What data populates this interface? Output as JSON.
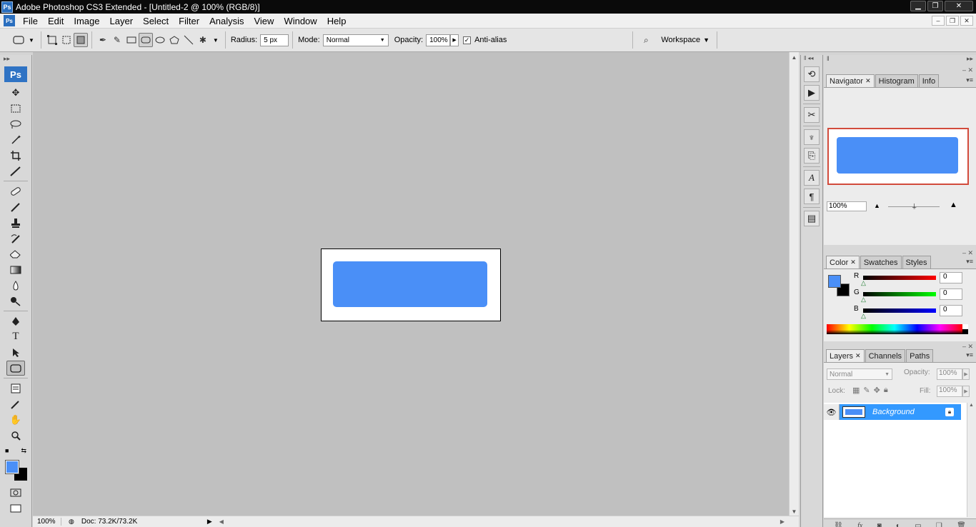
{
  "window": {
    "title": "Adobe Photoshop CS3 Extended - [Untitled-2 @ 100% (RGB/8)]",
    "app_logo": "Ps",
    "controls": [
      "▁",
      "❐",
      "✕"
    ]
  },
  "menu": {
    "items": [
      "File",
      "Edit",
      "Image",
      "Layer",
      "Select",
      "Filter",
      "Analysis",
      "View",
      "Window",
      "Help"
    ],
    "doc_controls": [
      "–",
      "❐",
      "✕"
    ]
  },
  "options": {
    "radius_label": "Radius:",
    "radius_value": "5 px",
    "mode_label": "Mode:",
    "mode_value": "Normal",
    "opacity_label": "Opacity:",
    "opacity_value": "100%",
    "antialias_label": "Anti-alias",
    "antialias_checked": "✓",
    "workspace_label": "Workspace"
  },
  "toolbox": {
    "logo": "Ps",
    "tools": [
      "move-icon",
      "marquee-icon",
      "lasso-icon",
      "magic-wand-icon",
      "crop-icon",
      "slice-icon",
      "healing-icon",
      "brush-icon",
      "stamp-icon",
      "history-brush-icon",
      "eraser-icon",
      "gradient-icon",
      "blur-icon",
      "dodge-icon",
      "pen-icon",
      "type-icon",
      "path-select-icon",
      "shape-icon",
      "notes-icon",
      "eyedropper-icon",
      "hand-icon",
      "zoom-icon"
    ],
    "type_glyph": "T"
  },
  "colors": {
    "foreground": "#4a8ff7",
    "background": "#000000",
    "shape_fill": "#4a8ff7",
    "layer_selected": "#3399ff"
  },
  "status": {
    "zoom": "100%",
    "doc": "Doc: 73.2K/73.2K"
  },
  "navigator": {
    "tabs": [
      "Navigator",
      "Histogram",
      "Info"
    ],
    "zoom": "100%"
  },
  "color_panel": {
    "tabs": [
      "Color",
      "Swatches",
      "Styles"
    ],
    "channels": [
      {
        "label": "R",
        "value": "0"
      },
      {
        "label": "G",
        "value": "0"
      },
      {
        "label": "B",
        "value": "0"
      }
    ]
  },
  "layers": {
    "tabs": [
      "Layers",
      "Channels",
      "Paths"
    ],
    "blend_mode": "Normal",
    "opacity_label": "Opacity:",
    "opacity_value": "100%",
    "lock_label": "Lock:",
    "fill_label": "Fill:",
    "fill_value": "100%",
    "layer_name": "Background",
    "footer_icons": [
      "link-icon",
      "fx-icon",
      "mask-icon",
      "adjustment-icon",
      "group-icon",
      "new-layer-icon",
      "trash-icon"
    ],
    "footer_fx": "fx"
  }
}
